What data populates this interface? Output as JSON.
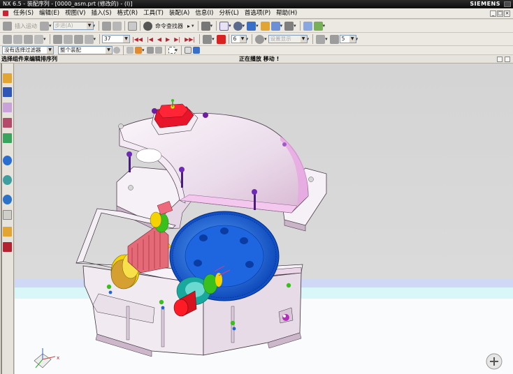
{
  "window": {
    "title": "NX 6.5 - 装配序列 - [0000_asm.prt (修改的) - (I)]",
    "brand": "SIEMENS"
  },
  "menu": {
    "items": [
      "任务(S)",
      "编辑(E)",
      "视图(V)",
      "插入(S)",
      "格式(R)",
      "工具(T)",
      "装配(A)",
      "信息(I)",
      "分析(L)",
      "首选项(P)",
      "帮助(H)"
    ]
  },
  "toolbar1": {
    "insert_sequence_label": "插入运动",
    "step_combo": "步进(A)",
    "command_finder_label": "命令查找器"
  },
  "toolbar2": {
    "step_value": "37",
    "speed_value": "6",
    "view_combo": "设置显示",
    "count_value": "5"
  },
  "selection": {
    "filter_value": "没有选择过滤器",
    "scope_value": "整个装配"
  },
  "cue_line": {
    "prompt": "选择组件来编辑排序列",
    "status": "正在播放 移动 !"
  },
  "colors": {
    "background_top": "#d6d6d6",
    "ground_band": "#cfd8f5",
    "housing": "#f2eef2",
    "housing_edge": "#c9a7c4",
    "gear_blue": "#1f63d6",
    "pinion_red": "#e46a78",
    "accent_yellow": "#f4d400",
    "accent_green": "#39c01d",
    "accent_teal": "#19a89d"
  },
  "icons": {
    "view_triad": "triad-icon",
    "zoom": "zoom-plus-icon"
  }
}
